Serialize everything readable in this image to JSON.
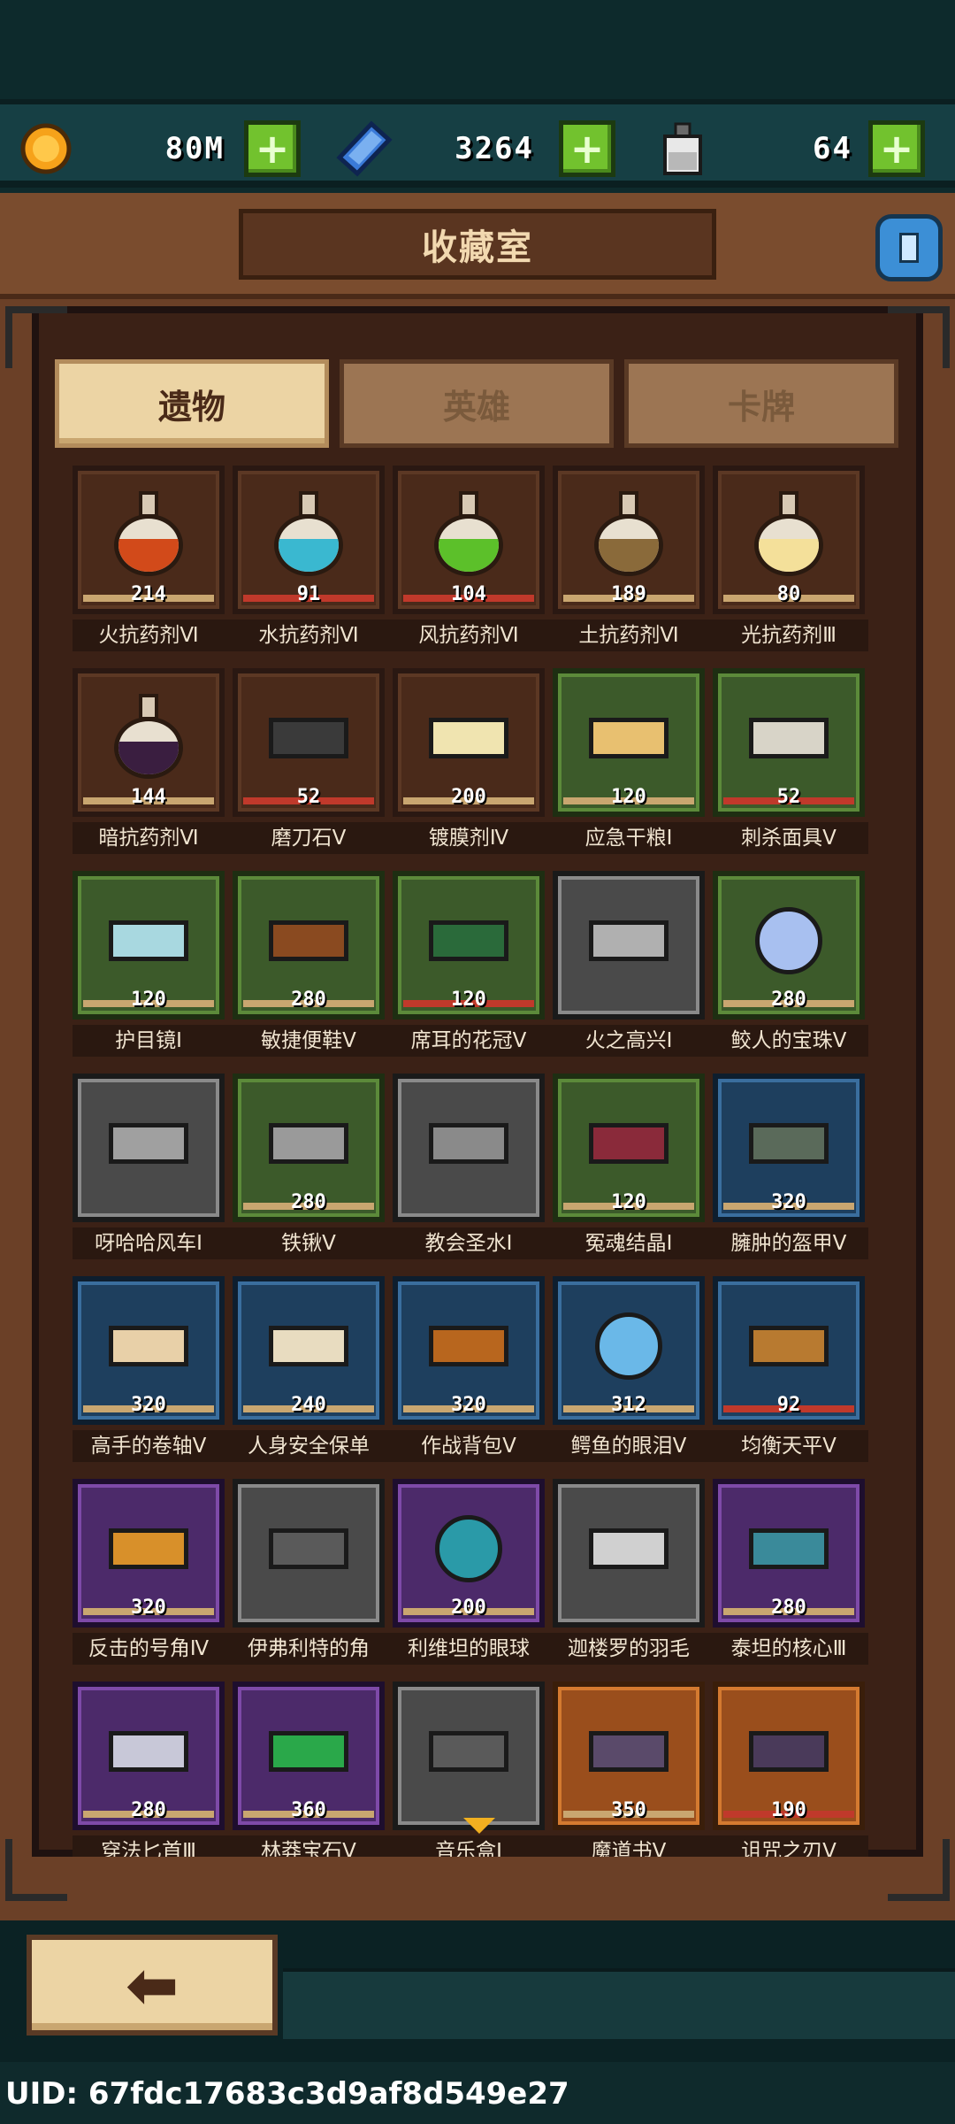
{
  "resources": {
    "gold": {
      "icon": "gold-coin-icon",
      "value": "80M"
    },
    "gem": {
      "icon": "blue-crystal-icon",
      "value": "3264"
    },
    "potion": {
      "icon": "bottle-icon",
      "value": "64"
    },
    "add_label": "+"
  },
  "header": {
    "title": "收藏室",
    "info_icon": "info-icon"
  },
  "tabs": [
    {
      "label": "遗物",
      "active": true
    },
    {
      "label": "英雄",
      "active": false
    },
    {
      "label": "卡牌",
      "active": false
    }
  ],
  "items": [
    {
      "name": "火抗药剂Ⅵ",
      "count": "214",
      "rarity": "brown",
      "icon": "potion-icon",
      "color": "#d24a1a",
      "bar": "normal"
    },
    {
      "name": "水抗药剂Ⅵ",
      "count": "91",
      "rarity": "brown",
      "icon": "potion-icon",
      "color": "#3ab8d0",
      "bar": "low"
    },
    {
      "name": "风抗药剂Ⅵ",
      "count": "104",
      "rarity": "brown",
      "icon": "potion-icon",
      "color": "#5cc02a",
      "bar": "low"
    },
    {
      "name": "土抗药剂Ⅵ",
      "count": "189",
      "rarity": "brown",
      "icon": "potion-icon",
      "color": "#8a6a3a",
      "bar": "normal"
    },
    {
      "name": "光抗药剂Ⅲ",
      "count": "80",
      "rarity": "brown",
      "icon": "potion-icon",
      "color": "#f4e09a",
      "bar": "normal"
    },
    {
      "name": "暗抗药剂Ⅵ",
      "count": "144",
      "rarity": "brown",
      "icon": "potion-icon",
      "color": "#3a1e40",
      "bar": "normal"
    },
    {
      "name": "磨刀石Ⅴ",
      "count": "52",
      "rarity": "brown",
      "icon": "whetstone-icon",
      "color": "#3a3a3a",
      "bar": "low"
    },
    {
      "name": "镀膜剂Ⅳ",
      "count": "200",
      "rarity": "brown",
      "icon": "coating-bottle-icon",
      "color": "#f0e4b0",
      "bar": "normal"
    },
    {
      "name": "应急干粮Ⅰ",
      "count": "120",
      "rarity": "green",
      "icon": "ration-icon",
      "color": "#e8c070",
      "bar": "normal"
    },
    {
      "name": "刺杀面具Ⅴ",
      "count": "52",
      "rarity": "green",
      "icon": "mask-icon",
      "color": "#d8d4c8",
      "bar": "low"
    },
    {
      "name": "护目镜Ⅰ",
      "count": "120",
      "rarity": "green",
      "icon": "goggles-icon",
      "color": "#a8d8e0",
      "bar": "normal"
    },
    {
      "name": "敏捷便鞋Ⅴ",
      "count": "280",
      "rarity": "green",
      "icon": "boot-icon",
      "color": "#8a4a20",
      "bar": "normal"
    },
    {
      "name": "席耳的花冠Ⅴ",
      "count": "120",
      "rarity": "green",
      "icon": "wreath-icon",
      "color": "#2a6a3a",
      "bar": "low"
    },
    {
      "name": "火之高兴Ⅰ",
      "count": "",
      "rarity": "gray",
      "icon": "sword-icon",
      "color": "#b0b0b0",
      "bar": "none"
    },
    {
      "name": "鲛人的宝珠Ⅴ",
      "count": "280",
      "rarity": "green",
      "icon": "pearl-icon",
      "color": "#a8c0f0",
      "bar": "normal"
    },
    {
      "name": "呀哈哈风车Ⅰ",
      "count": "",
      "rarity": "gray",
      "icon": "shuriken-icon",
      "color": "#a0a0a0",
      "bar": "none"
    },
    {
      "name": "铁锹Ⅴ",
      "count": "280",
      "rarity": "green",
      "icon": "shovel-icon",
      "color": "#9a9a9a",
      "bar": "normal"
    },
    {
      "name": "教会圣水Ⅰ",
      "count": "",
      "rarity": "gray",
      "icon": "chalice-icon",
      "color": "#8a8a8a",
      "bar": "none"
    },
    {
      "name": "冤魂结晶Ⅰ",
      "count": "120",
      "rarity": "green",
      "icon": "crystal-icon",
      "color": "#8a2a3a",
      "bar": "normal"
    },
    {
      "name": "臃肿的盔甲Ⅴ",
      "count": "320",
      "rarity": "blue",
      "icon": "armor-icon",
      "color": "#5a6a5a",
      "bar": "normal"
    },
    {
      "name": "高手的卷轴Ⅴ",
      "count": "320",
      "rarity": "blue",
      "icon": "scroll-icon",
      "color": "#e8d0a8",
      "bar": "normal"
    },
    {
      "name": "人身安全保单",
      "count": "240",
      "rarity": "blue",
      "icon": "paper-icon",
      "color": "#e8dcc0",
      "bar": "normal"
    },
    {
      "name": "作战背包Ⅴ",
      "count": "320",
      "rarity": "blue",
      "icon": "backpack-icon",
      "color": "#b8661e",
      "bar": "normal"
    },
    {
      "name": "鳄鱼的眼泪Ⅴ",
      "count": "312",
      "rarity": "blue",
      "icon": "teardrop-icon",
      "color": "#6ab8e8",
      "bar": "normal"
    },
    {
      "name": "均衡天平Ⅴ",
      "count": "92",
      "rarity": "blue",
      "icon": "scales-icon",
      "color": "#b87a30",
      "bar": "low"
    },
    {
      "name": "反击的号角Ⅳ",
      "count": "320",
      "rarity": "purple",
      "icon": "horn-icon",
      "color": "#d8902a",
      "bar": "normal"
    },
    {
      "name": "伊弗利特的角",
      "count": "",
      "rarity": "gray",
      "icon": "demon-horn-icon",
      "color": "#5a5a5a",
      "bar": "none"
    },
    {
      "name": "利维坦的眼球",
      "count": "200",
      "rarity": "purple",
      "icon": "eyeball-icon",
      "color": "#2a9aa8",
      "bar": "normal"
    },
    {
      "name": "迦楼罗的羽毛",
      "count": "",
      "rarity": "gray",
      "icon": "feather-icon",
      "color": "#d0d0d0",
      "bar": "none"
    },
    {
      "name": "泰坦的核心Ⅲ",
      "count": "280",
      "rarity": "purple",
      "icon": "titan-core-icon",
      "color": "#3a8a9a",
      "bar": "normal"
    },
    {
      "name": "穿法匕首Ⅲ",
      "count": "280",
      "rarity": "purple",
      "icon": "dagger-icon",
      "color": "#c8c8d8",
      "bar": "normal"
    },
    {
      "name": "林莽宝石Ⅴ",
      "count": "360",
      "rarity": "purple",
      "icon": "emerald-icon",
      "color": "#2aa84a",
      "bar": "normal"
    },
    {
      "name": "音乐盒Ⅰ",
      "count": "",
      "rarity": "gray",
      "icon": "music-box-icon",
      "color": "#5a5a5a",
      "bar": "none"
    },
    {
      "name": "魔道书Ⅴ",
      "count": "350",
      "rarity": "orange",
      "icon": "tome-icon",
      "color": "#5a4a6a",
      "bar": "normal"
    },
    {
      "name": "诅咒之刃Ⅴ",
      "count": "190",
      "rarity": "orange",
      "icon": "cursed-blade-icon",
      "color": "#4a3a5a",
      "bar": "low"
    }
  ],
  "footer": {
    "back_icon": "back-arrow-icon",
    "back_glyph": "⬅",
    "uid": "UID: 67fdc17683c3d9af8d549e27"
  }
}
